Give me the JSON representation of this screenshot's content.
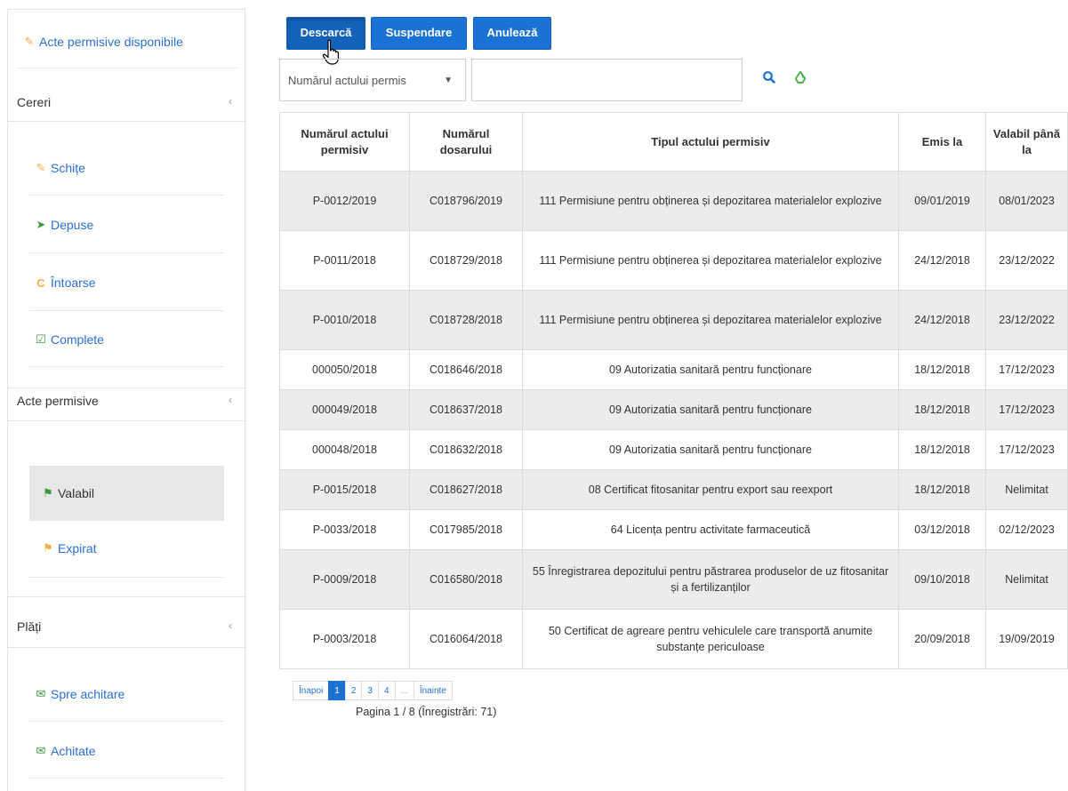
{
  "sidebar": {
    "top_link": {
      "label": "Acte permisive disponibile",
      "icon": "edit-icon"
    },
    "sections": [
      {
        "title": "Cereri",
        "items": [
          "Schițe",
          "Depuse",
          "Întoarse",
          "Complete"
        ]
      },
      {
        "title": "Acte permisive",
        "items": [
          "Valabil",
          "Expirat"
        ]
      },
      {
        "title": "Plăți",
        "items": [
          "Spre achitare",
          "Achitate"
        ]
      }
    ],
    "chevron": "‹"
  },
  "toolbar": {
    "download_label": "Descarcă",
    "suspend_label": "Suspendare",
    "cancel_label": "Anulează"
  },
  "filter": {
    "field_label": "Numărul actului permis",
    "search_value": ""
  },
  "table": {
    "headers": [
      "Numărul actului permisiv",
      "Numărul dosarului",
      "Tipul actului permisiv",
      "Emis la",
      "Valabil până la"
    ],
    "rows": [
      [
        "P-0012/2019",
        "C018796/2019",
        "111 Permisiune pentru obținerea și depozitarea materialelor explozive",
        "09/01/2019",
        "08/01/2023"
      ],
      [
        "P-0011/2018",
        "C018729/2018",
        "111 Permisiune pentru obținerea și depozitarea materialelor explozive",
        "24/12/2018",
        "23/12/2022"
      ],
      [
        "P-0010/2018",
        "C018728/2018",
        "111 Permisiune pentru obținerea și depozitarea materialelor explozive",
        "24/12/2018",
        "23/12/2022"
      ],
      [
        "000050/2018",
        "C018646/2018",
        "09 Autorizatia sanitară pentru funcționare",
        "18/12/2018",
        "17/12/2023"
      ],
      [
        "000049/2018",
        "C018637/2018",
        "09 Autorizatia sanitară pentru funcționare",
        "18/12/2018",
        "17/12/2023"
      ],
      [
        "000048/2018",
        "C018632/2018",
        "09 Autorizatia sanitară pentru funcționare",
        "18/12/2018",
        "17/12/2023"
      ],
      [
        "P-0015/2018",
        "C018627/2018",
        "08 Certificat fitosanitar pentru export sau reexport",
        "18/12/2018",
        "Nelimitat"
      ],
      [
        "P-0033/2018",
        "C017985/2018",
        "64 Licența pentru activitate farmaceutică",
        "03/12/2018",
        "02/12/2023"
      ],
      [
        "P-0009/2018",
        "C016580/2018",
        "55 Înregistrarea depozitului pentru păstrarea produselor de uz fitosanitar și a fertilizanților",
        "09/10/2018",
        "Nelimitat"
      ],
      [
        "P-0003/2018",
        "C016064/2018",
        "50 Certificat de agreare pentru vehiculele care transportă anumite substanțe periculoase",
        "20/09/2018",
        "19/09/2019"
      ]
    ]
  },
  "pagination": {
    "prev_label": "Înapoi",
    "pages": [
      "1",
      "2",
      "3",
      "4"
    ],
    "ellipsis": "...",
    "next_label": "Înainte",
    "active_page": "1",
    "info": "Pagina 1 / 8 (Înregistrări: 71)"
  },
  "colors": {
    "primary": "#1a73d4",
    "link": "#2a6fd6",
    "row_alt": "#ececec",
    "warning_icon": "#f0ad4e",
    "success_icon": "#3c9a3c"
  }
}
